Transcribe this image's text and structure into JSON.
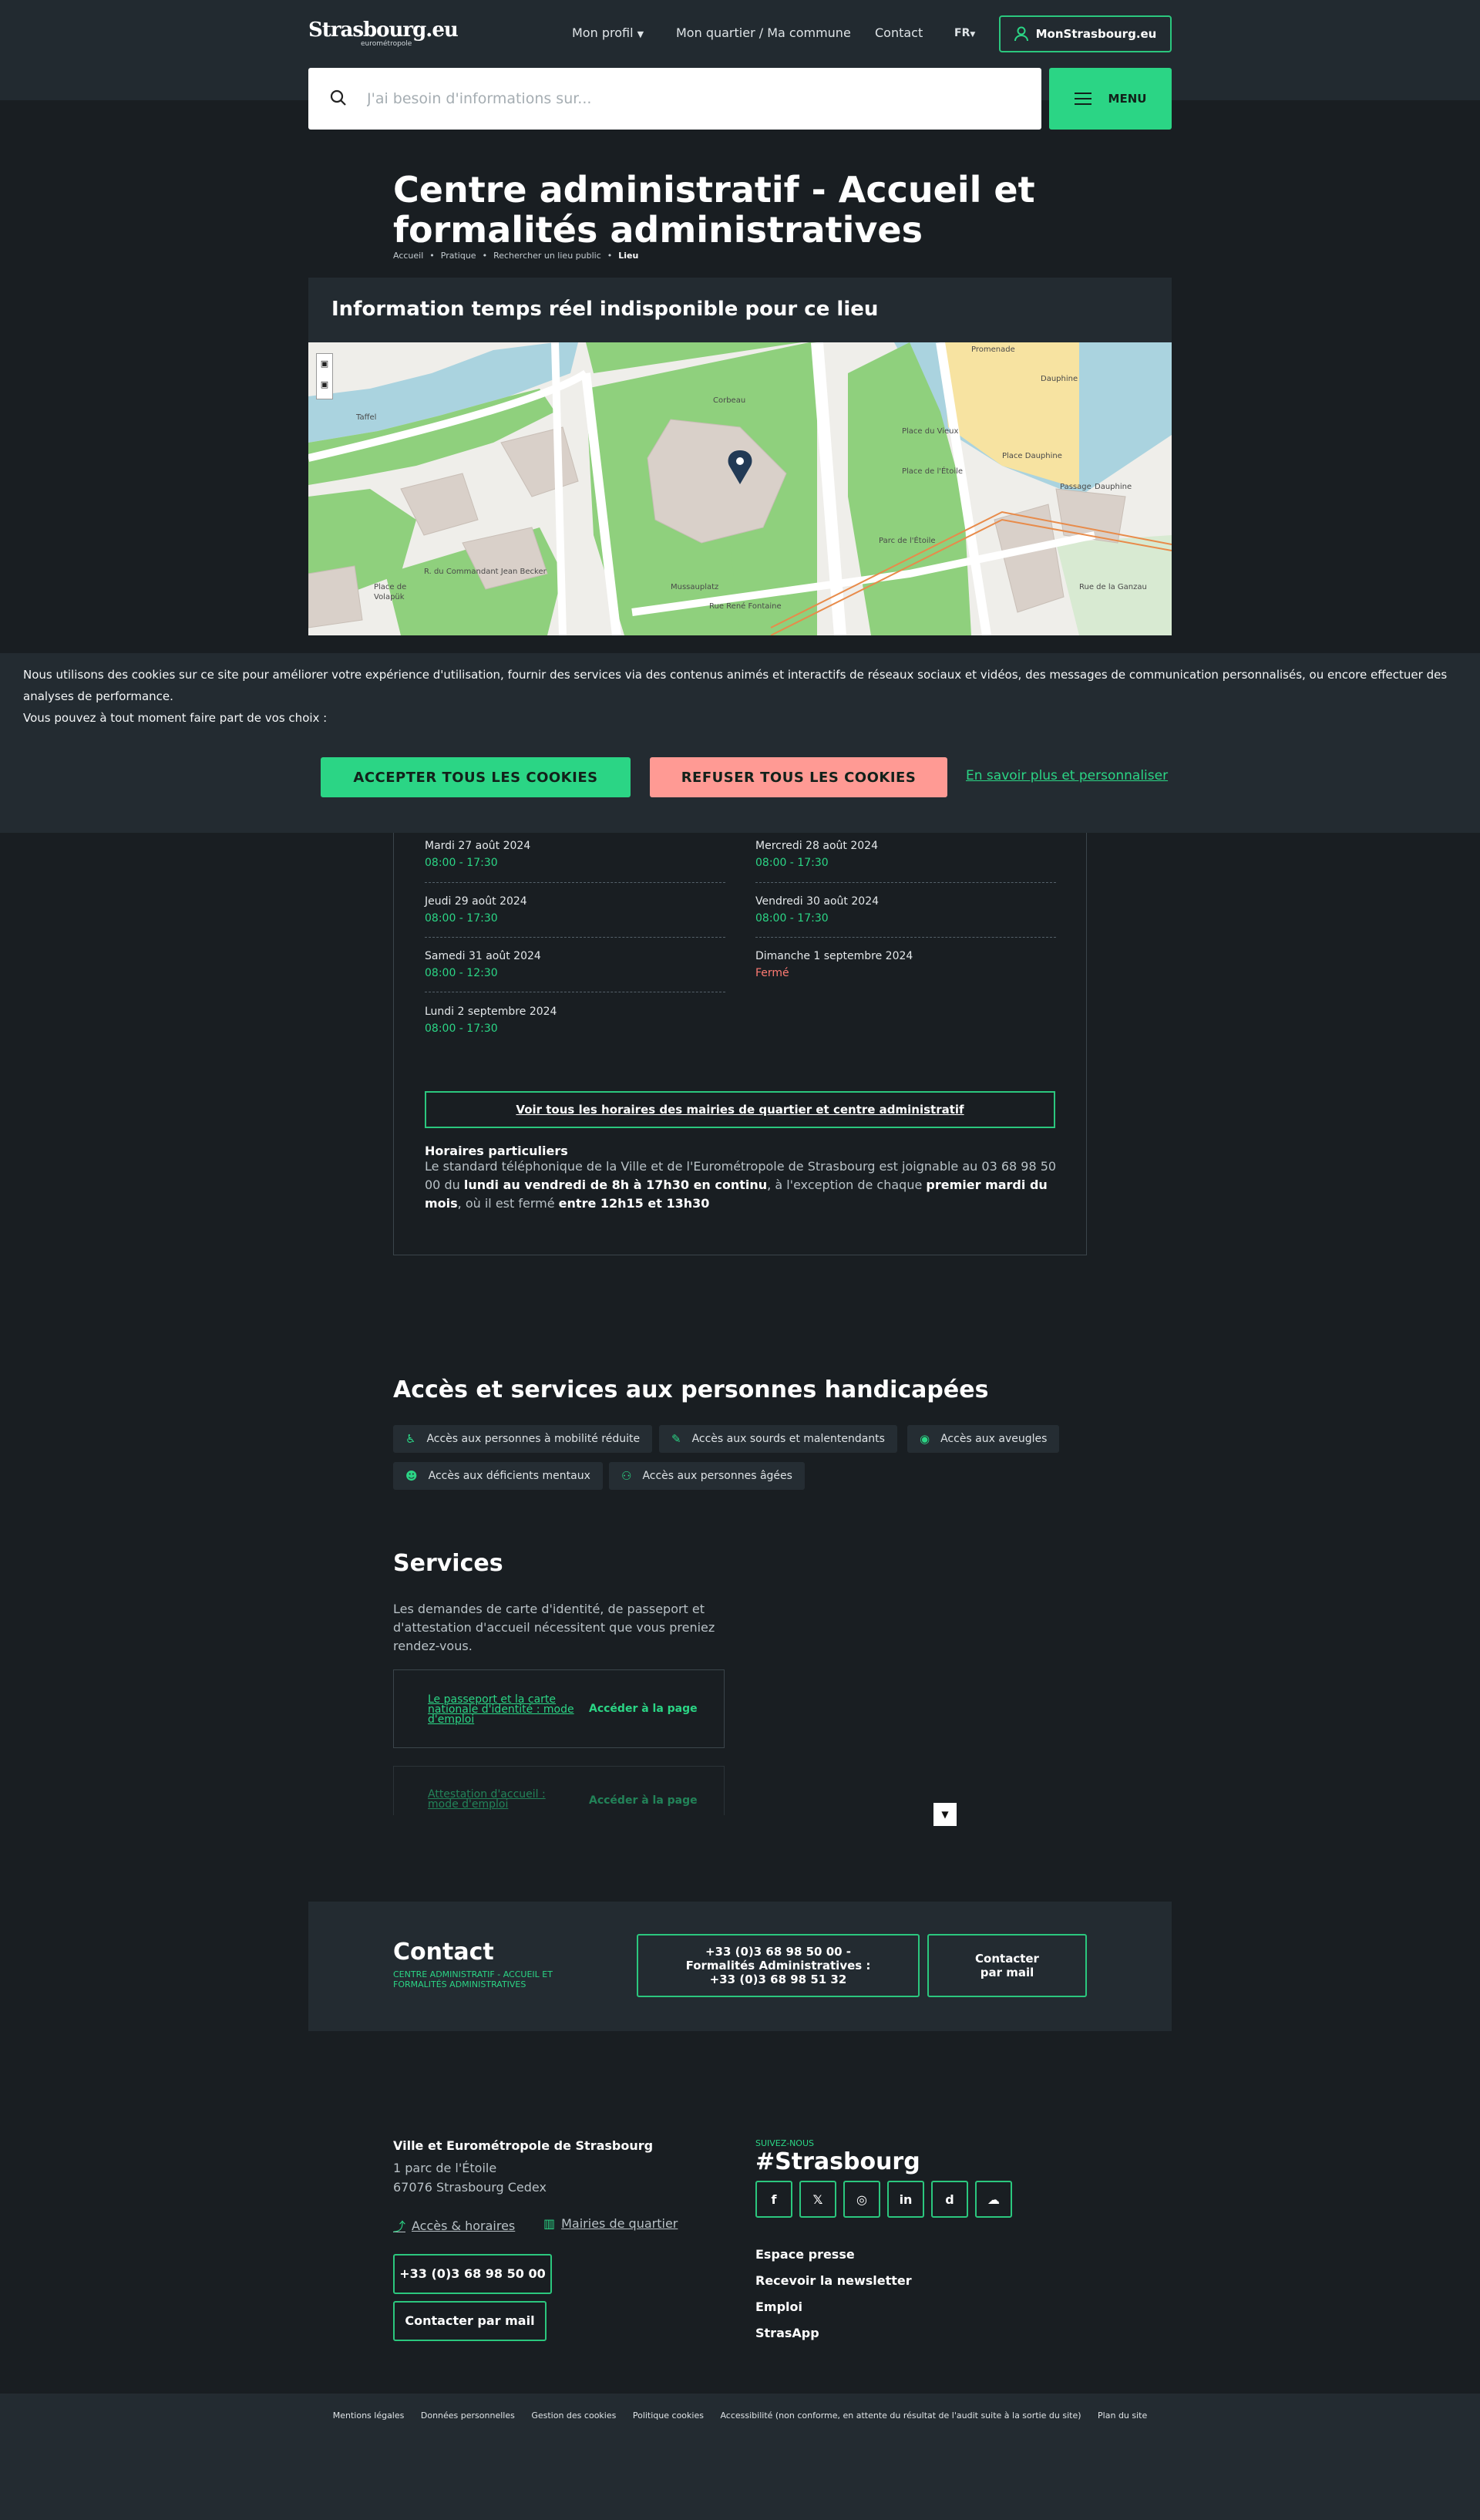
{
  "header": {
    "logo_main": "Strasbourg.eu",
    "logo_sub": "eurométropole",
    "nav": [
      "Mon profil",
      "Mon quartier / Ma commune",
      "Contact"
    ],
    "lang": "FR",
    "account_label": "MonStrasbourg.eu",
    "search_placeholder": "J'ai besoin d'informations sur...",
    "menu_label": "MENU"
  },
  "page": {
    "title": "Centre administratif - Accueil et formalités administratives",
    "breadcrumb": [
      "Accueil",
      "Pratique",
      "Rechercher un lieu public",
      "Lieu"
    ],
    "realtime_banner": "Information temps réel indisponible pour ce lieu"
  },
  "map_labels": [
    "Corbeau",
    "Taffel",
    "Promenade",
    "Place du Vieux",
    "Dauphine",
    "Place Dauphine",
    "Passage",
    "Dauphine",
    "R. du Commandant Jean Becker",
    "Place de",
    "Volapük",
    "Rue René Fontaine",
    "Place de l'Étoile",
    "Parc de l'Étoile",
    "Mussauplatz",
    "Rue de la Ganzau"
  ],
  "cookie": {
    "line1": "Nous utilisons des cookies sur ce site pour améliorer votre expérience d'utilisation, fournir des services via des contenus animés et interactifs de réseaux sociaux et vidéos, des messages de communication personnalisés, ou encore effectuer des analyses de performance.",
    "line2": "Vous pouvez à tout moment faire part de vos choix :",
    "accept": "ACCEPTER TOUS LES COOKIES",
    "refuse": "REFUSER TOUS LES COOKIES",
    "customize": "En savoir plus et personnaliser"
  },
  "hours": {
    "days": [
      {
        "date": "Mardi 27 août 2024",
        "hours": "08:00 - 17:30"
      },
      {
        "date": "Mercredi 28 août 2024",
        "hours": "08:00 - 17:30"
      },
      {
        "date": "Jeudi 29 août 2024",
        "hours": "08:00 - 17:30"
      },
      {
        "date": "Vendredi 30 août 2024",
        "hours": "08:00 - 17:30"
      },
      {
        "date": "Samedi 31 août 2024",
        "hours": "08:00 - 12:30"
      },
      {
        "date": "Dimanche 1 septembre 2024",
        "hours": "Fermé"
      },
      {
        "date": "Lundi 2 septembre 2024",
        "hours": "08:00 - 17:30"
      }
    ],
    "all_hours_button": "Voir tous les horaires des mairies de quartier et centre administratif",
    "special_title": "Horaires particuliers",
    "special_1": "Le standard téléphonique de la Ville et de l'Eurométropole de Strasbourg est joignable au 03 68 98 50 00 du ",
    "special_b1": "lundi au vendredi de 8h à 17h30 en continu",
    "special_2": ", à l'exception de chaque ",
    "special_b2": "premier mardi du mois",
    "special_3": ", où il est fermé ",
    "special_b3": "entre 12h15 et 13h30"
  },
  "accessibility": {
    "title": "Accès et services aux personnes handicapées",
    "tags": [
      "Accès aux personnes à mobilité réduite",
      "Accès aux sourds et malentendants",
      "Accès aux aveugles",
      "Accès aux déficients mentaux",
      "Accès aux personnes âgées"
    ]
  },
  "services": {
    "title": "Services",
    "intro": "Les demandes de carte d'identité, de passeport et d'attestation d'accueil nécessitent que vous preniez rendez-vous.",
    "cards": [
      {
        "link": "Le passeport et la carte nationale d'identité : mode d'emploi",
        "action": "Accéder à la page"
      },
      {
        "link": "Attestation d'accueil : mode d'emploi",
        "action": "Accéder à la page"
      }
    ]
  },
  "contact": {
    "title": "Contact",
    "subtitle": "Centre administratif - Accueil et formalités administratives",
    "phone_line1": "+33 (0)3 68 98 50 00 -",
    "phone_line2": "Formalités Administratives :",
    "phone_line3": "+33 (0)3 68 98 51 32",
    "mail_line1": "Contacter",
    "mail_line2": "par mail"
  },
  "footer": {
    "org": "Ville et Eurométropole de Strasbourg",
    "addr1": "1 parc de l'Étoile",
    "addr2": "67076 Strasbourg Cedex",
    "link_hours": "Accès & horaires",
    "link_mairies": "Mairies de quartier",
    "phone": "+33 (0)3 68 98 50 00",
    "mail": "Contacter par mail",
    "follow": "Suivez-nous",
    "hashtag": "#Strasbourg",
    "socials": [
      "f",
      "𝕏",
      "◎",
      "in",
      "d",
      "☁"
    ],
    "side_links": [
      "Espace presse",
      "Recevoir la newsletter",
      "Emploi",
      "StrasApp"
    ],
    "legal": [
      "Mentions légales",
      "Données personnelles",
      "Gestion des cookies",
      "Politique cookies",
      "Accessibilité (non conforme, en attente du résultat de l'audit suite à la sortie du site)",
      "Plan du site"
    ]
  },
  "colors": {
    "accent": "#2bd585",
    "bg": "#191e22",
    "panel": "#232b31",
    "refuse": "#ff9a94"
  }
}
